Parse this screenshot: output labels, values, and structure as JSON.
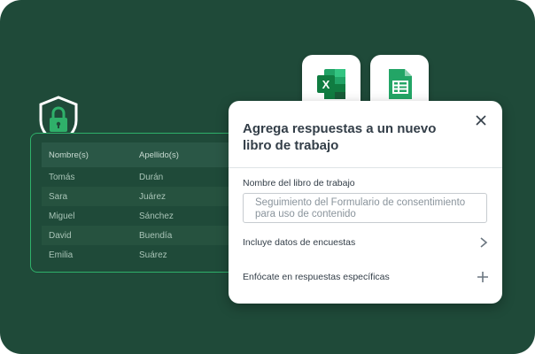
{
  "table": {
    "headers": [
      "Nombre(s)",
      "Apellido(s)"
    ],
    "rows": [
      [
        "Tomás",
        "Durán"
      ],
      [
        "Sara",
        "Juárez"
      ],
      [
        "Miguel",
        "Sánchez"
      ],
      [
        "David",
        "Buendía"
      ],
      [
        "Emilia",
        "Suárez"
      ]
    ]
  },
  "apps": [
    {
      "name": "excel-icon",
      "color": "#1d6f42"
    },
    {
      "name": "sheets-icon",
      "color": "#23a566"
    }
  ],
  "dialog": {
    "title": "Agrega respuestas a un nuevo libro de trabajo",
    "field_label": "Nombre del libro de trabajo",
    "field_placeholder": "Seguimiento del Formulario de consentimiento para uso de contenido",
    "option1_label": "Incluye datos de encuestas",
    "option2_label": "Enfócate en respuestas específicas"
  },
  "colors": {
    "background": "#1f4a39",
    "accent": "#2fb06a",
    "text": "#333e48"
  }
}
